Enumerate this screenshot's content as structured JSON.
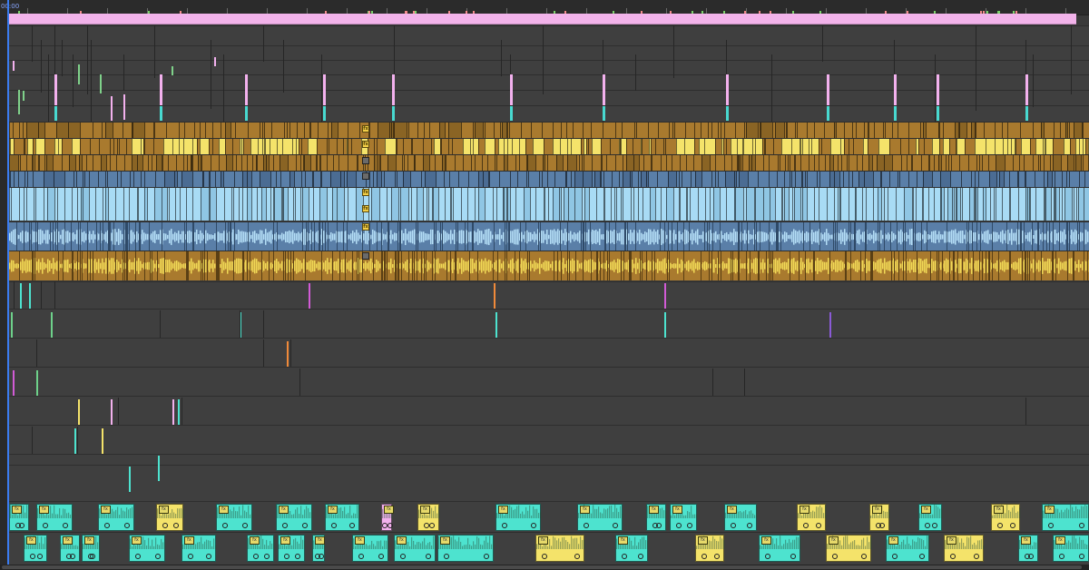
{
  "ruler": {
    "timecode": "00:00"
  },
  "workarea_color": "#f2b3ea",
  "colors": {
    "gold_clip": "#a97a2e",
    "yellow_clip": "#f4e36a",
    "blue_clip": "#5a7fa8",
    "lightblue_clip": "#a8dbf5",
    "cyan_clip": "#4de3cf",
    "pink_marker": "#f3b1ee",
    "cyan_marker": "#48d9d0",
    "track_bg": "#3f3f3f"
  },
  "clip_effect_label": "fx",
  "icons": {
    "effect_badge": "fx-badge-icon",
    "playhead": "playhead-icon",
    "marker": "marker-icon"
  }
}
